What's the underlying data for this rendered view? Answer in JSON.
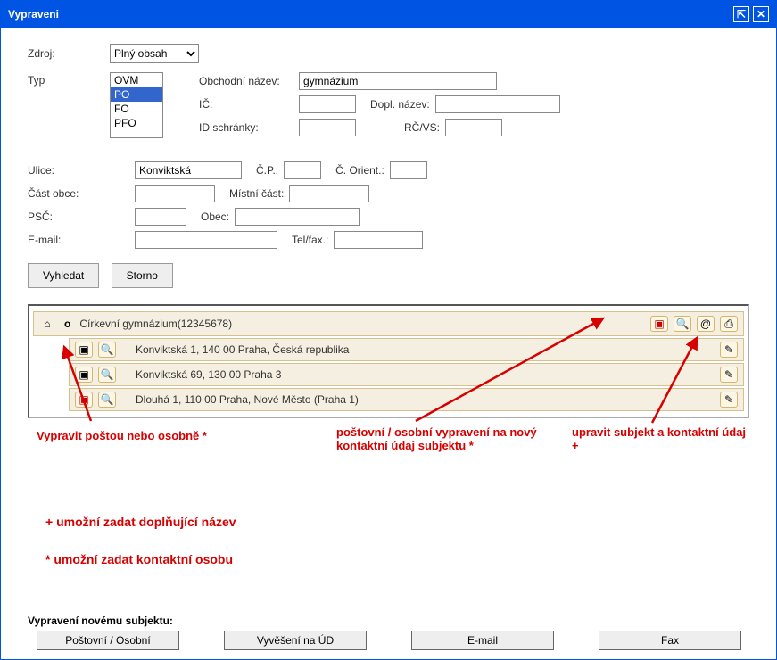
{
  "window": {
    "title": "Vypraveni"
  },
  "form": {
    "zdroj_label": "Zdroj:",
    "zdroj_value": "Plný obsah",
    "typ_label": "Typ",
    "typ_options": [
      "OVM",
      "PO",
      "FO",
      "PFO"
    ],
    "typ_selected": "PO",
    "obchodni_nazev_label": "Obchodní název:",
    "obchodni_nazev_value": "gymnázium",
    "ic_label": "IČ:",
    "ic_value": "",
    "dopl_nazev_label": "Dopl. název:",
    "dopl_nazev_value": "",
    "id_schranky_label": "ID schránky:",
    "id_schranky_value": "",
    "rcvs_label": "RČ/VS:",
    "rcvs_value": "",
    "ulice_label": "Ulice:",
    "ulice_value": "Konviktská",
    "cp_label": "Č.P.:",
    "cp_value": "",
    "corient_label": "Č. Orient.:",
    "corient_value": "",
    "castobce_label": "Část obce:",
    "castobce_value": "",
    "mistnicast_label": "Místní část:",
    "mistnicast_value": "",
    "psc_label": "PSČ:",
    "psc_value": "",
    "obec_label": "Obec:",
    "obec_value": "",
    "email_label": "E-mail:",
    "email_value": "",
    "telfax_label": "Tel/fax.:",
    "telfax_value": ""
  },
  "buttons": {
    "vyhledat": "Vyhledat",
    "storno": "Storno"
  },
  "results": {
    "subject_badge": "o",
    "subject_title": "Církevní gymnázium(12345678)",
    "addresses": [
      "Konviktská 1, 140 00 Praha, Česká republika",
      "Konviktská 69, 130 00 Praha 3",
      "Dlouhá 1, 110 00 Praha, Nové Město (Praha 1)"
    ]
  },
  "annotations": {
    "left": "Vypravit poštou nebo osobně *",
    "middle": "poštovní / osobní vypravení na nový kontaktní údaj subjektu *",
    "right": "upravit subjekt a kontaktní údaj +",
    "note1": "+ umožní zadat doplňující název",
    "note2": "* umožní zadat kontaktní osobu"
  },
  "footer": {
    "title": "Vypravení novému subjektu:",
    "buttons": [
      "Poštovní / Osobní",
      "Vyvěšení na ÚD",
      "E-mail",
      "Fax"
    ]
  },
  "icons": {
    "home": "⌂",
    "post": "▣",
    "search": "🔍",
    "at": "@",
    "print": "⎙",
    "edit": "✎"
  }
}
